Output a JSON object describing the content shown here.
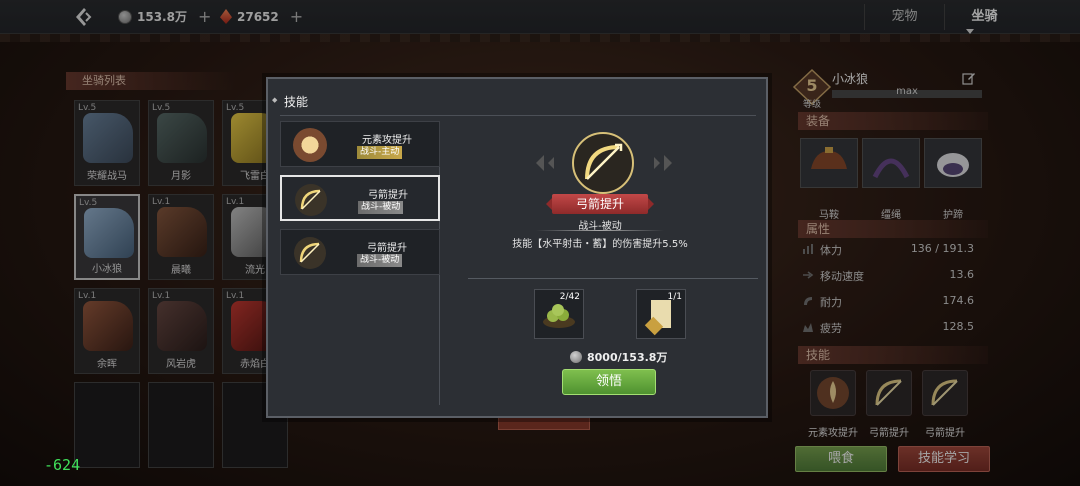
{
  "topbar": {
    "currency1": "153.8万",
    "currency2": "27652",
    "plus": "+",
    "tabs": [
      "宠物",
      "坐骑"
    ],
    "active_tab": "坐骑"
  },
  "mount_list": {
    "title": "坐骑列表",
    "cards": [
      {
        "lv": "Lv.5",
        "name": "荣耀战马"
      },
      {
        "lv": "Lv.5",
        "name": "月影"
      },
      {
        "lv": "Lv.5",
        "name": "飞雷白"
      },
      {
        "lv": "Lv.5",
        "name": "小冰狼"
      },
      {
        "lv": "Lv.1",
        "name": "晨曦"
      },
      {
        "lv": "Lv.1",
        "name": "流光"
      },
      {
        "lv": "Lv.1",
        "name": "余晖"
      },
      {
        "lv": "Lv.1",
        "name": "风岩虎"
      },
      {
        "lv": "Lv.1",
        "name": "赤焰白"
      }
    ]
  },
  "right_panel": {
    "level": "5",
    "level_label": "等级",
    "mount_name": "小冰狼",
    "max_text": "max",
    "equip_header": "装备",
    "equipment": [
      "马鞍",
      "缰绳",
      "护蹄"
    ],
    "attr_header": "属性",
    "attributes": [
      {
        "key": "体力",
        "value": "136 / 191.3"
      },
      {
        "key": "移动速度",
        "value": "13.6"
      },
      {
        "key": "耐力",
        "value": "174.6"
      },
      {
        "key": "疲劳",
        "value": "128.5"
      }
    ],
    "skills_header": "技能",
    "skills": [
      "元素攻提升",
      "弓箭提升",
      "弓箭提升"
    ],
    "feed_button": "喂食",
    "learn_button": "技能学习"
  },
  "modal": {
    "title": "技能",
    "skill_items": [
      {
        "name": "元素攻提升",
        "tag": "战斗-主动"
      },
      {
        "name": "弓箭提升",
        "tag": "战斗-被动"
      },
      {
        "name": "弓箭提升",
        "tag": "战斗-被动"
      }
    ],
    "detail": {
      "name": "弓箭提升",
      "type": "战斗-被动",
      "desc": "技能【水平射击・蓄】的伤害提升5.5%",
      "material1_count": "2/42",
      "material2_count": "1/1",
      "cost": "8000/153.8万",
      "button": "领悟"
    }
  },
  "debug_text": "-624",
  "colors": {
    "accent_green": "#6aa944",
    "accent_red": "#a0463a",
    "gold": "#e2c86a"
  }
}
